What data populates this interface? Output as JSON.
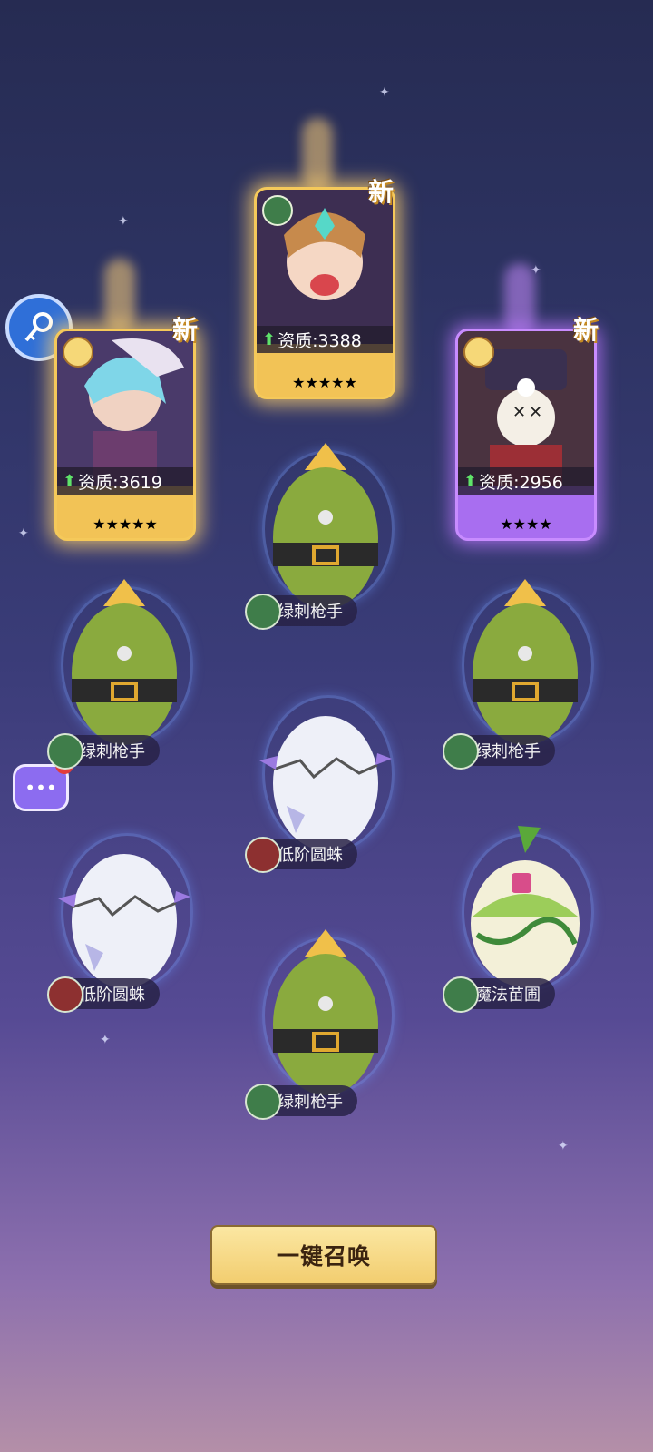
{
  "heroes": [
    {
      "quality_label": "资质:3619",
      "stars": "★★★★★",
      "new_label": "新"
    },
    {
      "quality_label": "资质:3388",
      "stars": "★★★★★",
      "new_label": "新"
    },
    {
      "quality_label": "资质:2956",
      "stars": "★★★★",
      "new_label": "新"
    }
  ],
  "eggs": [
    {
      "name": "绿刺枪手",
      "type": "cactus",
      "faction": "leaf"
    },
    {
      "name": "绿刺枪手",
      "type": "cactus",
      "faction": "leaf"
    },
    {
      "name": "绿刺枪手",
      "type": "cactus",
      "faction": "leaf"
    },
    {
      "name": "低阶圆蛛",
      "type": "cracked",
      "faction": "skull"
    },
    {
      "name": "低阶圆蛛",
      "type": "cracked",
      "faction": "skull"
    },
    {
      "name": "魔法苗圃",
      "type": "sprout",
      "faction": "leaf"
    },
    {
      "name": "绿刺枪手",
      "type": "cactus",
      "faction": "leaf"
    }
  ],
  "summon_button": {
    "label": "一键召唤"
  },
  "colors": {
    "gold": "#f5c95a",
    "purple": "#c88cff",
    "leaf": "#3f7d4a",
    "skull": "#8d3030"
  }
}
